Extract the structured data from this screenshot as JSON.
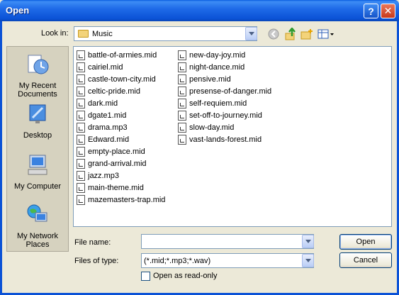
{
  "window": {
    "title": "Open",
    "help_glyph": "?",
    "close_glyph": "✕"
  },
  "lookin": {
    "label": "Look in:",
    "value": "Music"
  },
  "places": [
    {
      "label_line1": "My Recent",
      "label_line2": "Documents",
      "icon": "recent-documents-icon"
    },
    {
      "label_line1": "Desktop",
      "label_line2": "",
      "icon": "desktop-icon"
    },
    {
      "label_line1": "My Computer",
      "label_line2": "",
      "icon": "my-computer-icon"
    },
    {
      "label_line1": "My Network",
      "label_line2": "Places",
      "icon": "network-places-icon"
    }
  ],
  "files": [
    "battle-of-armies.mid",
    "cairiel.mid",
    "castle-town-city.mid",
    "celtic-pride.mid",
    "dark.mid",
    "dgate1.mid",
    "drama.mp3",
    "Edward.mid",
    "empty-place.mid",
    "grand-arrival.mid",
    "jazz.mp3",
    "main-theme.mid",
    "mazemasters-trap.mid",
    "new-day-joy.mid",
    "night-dance.mid",
    "pensive.mid",
    "presense-of-danger.mid",
    "self-requiem.mid",
    "set-off-to-journey.mid",
    "slow-day.mid",
    "vast-lands-forest.mid"
  ],
  "filename": {
    "label": "File name:",
    "value": ""
  },
  "filetype": {
    "label": "Files of type:",
    "value": "(*.mid;*.mp3;*.wav)"
  },
  "readonly": {
    "label": "Open as read-only",
    "checked": false
  },
  "buttons": {
    "open": "Open",
    "cancel": "Cancel"
  }
}
